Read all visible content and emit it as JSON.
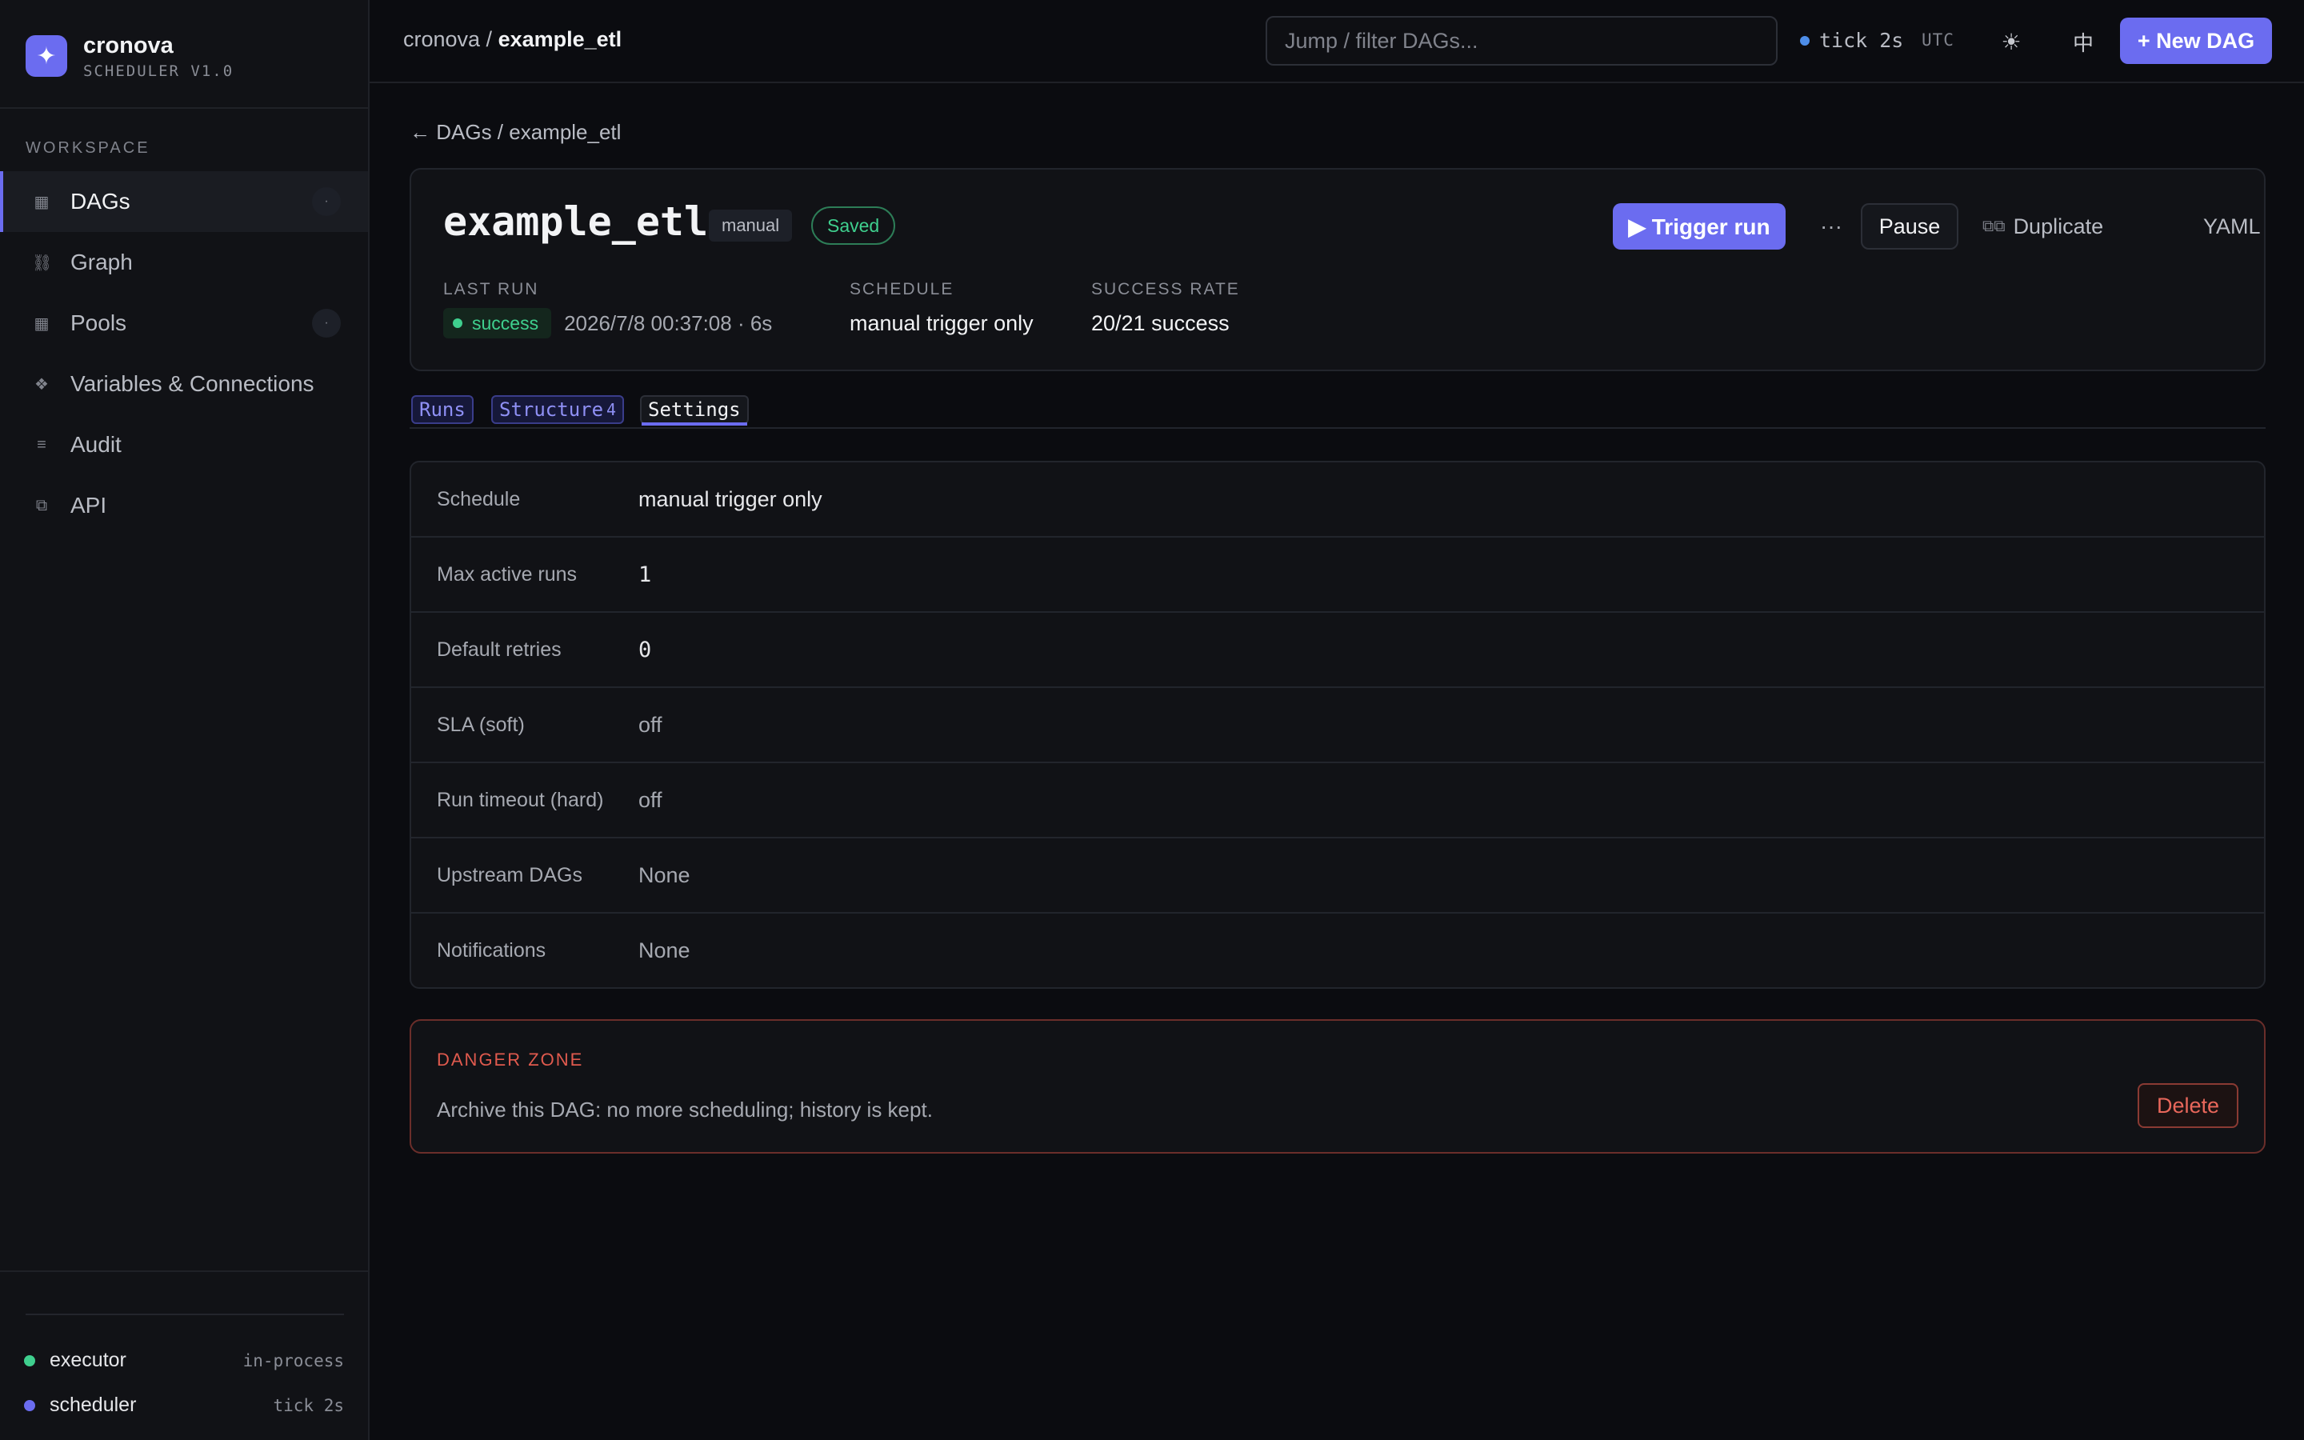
{
  "brand": {
    "name": "cronova",
    "subtitle": "SCHEDULER V1.0",
    "logo_icon": "sparkle-icon",
    "logo_glyph": "✦"
  },
  "sidebar": {
    "section_label": "WORKSPACE",
    "items": [
      {
        "label": "DAGs",
        "icon": "grid-icon",
        "glyph": "▦",
        "badge": "·",
        "active": true
      },
      {
        "label": "Graph",
        "icon": "link-icon",
        "glyph": "⛓"
      },
      {
        "label": "Pools",
        "icon": "pool-icon",
        "glyph": "▦",
        "badge": "·"
      },
      {
        "label": "Variables & Connections",
        "icon": "diamond-icon",
        "glyph": "❖"
      },
      {
        "label": "Audit",
        "icon": "list-icon",
        "glyph": "≡"
      },
      {
        "label": "API",
        "icon": "api-icon",
        "glyph": "⧉"
      }
    ],
    "status": [
      {
        "name": "executor",
        "value": "in-process",
        "color": "#3fcf8e"
      },
      {
        "name": "scheduler",
        "value": "tick 2s",
        "color": "#6b6cf0"
      }
    ]
  },
  "topbar": {
    "breadcrumb_root": "cronova / ",
    "breadcrumb_current": "example_etl",
    "search_placeholder": "Jump / filter DAGs...",
    "tick": "tick 2s",
    "timezone": "UTC",
    "theme_icon": "☀",
    "lang_label": "中",
    "new_dag_label": "+ New DAG"
  },
  "main": {
    "back_breadcrumb": "← DAGs / example_etl",
    "dag": {
      "title": "example_etl",
      "trigger_tag": "manual",
      "saved_tag": "Saved",
      "trigger_label": "▶ Trigger run",
      "more_label": "···",
      "pause_label": "Pause",
      "duplicate_icon": "⧉⧉",
      "duplicate_label": "Duplicate",
      "yaml_label": "YAML",
      "meta": {
        "last_run_label": "LAST RUN",
        "last_run_status": "success",
        "last_run_time": "2026/7/8 00:37:08 · 6s",
        "schedule_label": "SCHEDULE",
        "schedule_value": "manual trigger only",
        "success_rate_label": "SUCCESS RATE",
        "success_rate_value": "20/21 success"
      }
    },
    "tabs": [
      {
        "label": "Runs",
        "active": false
      },
      {
        "label": "Structure",
        "count": "4",
        "active": false
      },
      {
        "label": "Settings",
        "active": true
      }
    ],
    "settings": [
      {
        "label": "Schedule",
        "value": "manual trigger only"
      },
      {
        "label": "Max active runs",
        "value": "1"
      },
      {
        "label": "Default retries",
        "value": "0"
      },
      {
        "label": "SLA (soft)",
        "value": "off"
      },
      {
        "label": "Run timeout (hard)",
        "value": "off"
      },
      {
        "label": "Upstream DAGs",
        "value": "None"
      },
      {
        "label": "Notifications",
        "value": "None"
      }
    ],
    "danger_zone": {
      "title": "DANGER ZONE",
      "text": "Archive this DAG: no more scheduling; history is kept.",
      "delete_label": "Delete"
    }
  },
  "colors": {
    "accent": "#6b6cf0",
    "success": "#3fcf8e",
    "danger": "#e05a4e",
    "background": "#0b0c10"
  }
}
